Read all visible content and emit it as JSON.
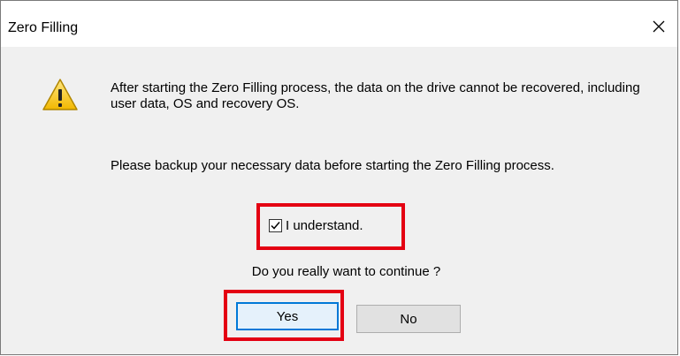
{
  "window": {
    "title": "Zero Filling"
  },
  "message": {
    "line1": "After starting the Zero Filling process, the data on the drive cannot be recovered, including user data, OS and recovery OS.",
    "line2": "Please backup your necessary data before starting the Zero Filling process."
  },
  "confirm": {
    "label": "I understand.",
    "checked": true
  },
  "question": "Do you really want to continue ?",
  "buttons": {
    "yes": "Yes",
    "no": "No"
  },
  "colors": {
    "highlight": "#e40012",
    "accent": "#0078d7"
  },
  "icons": {
    "warning": "warning-icon",
    "close": "close-icon",
    "check": "checkmark-icon"
  }
}
